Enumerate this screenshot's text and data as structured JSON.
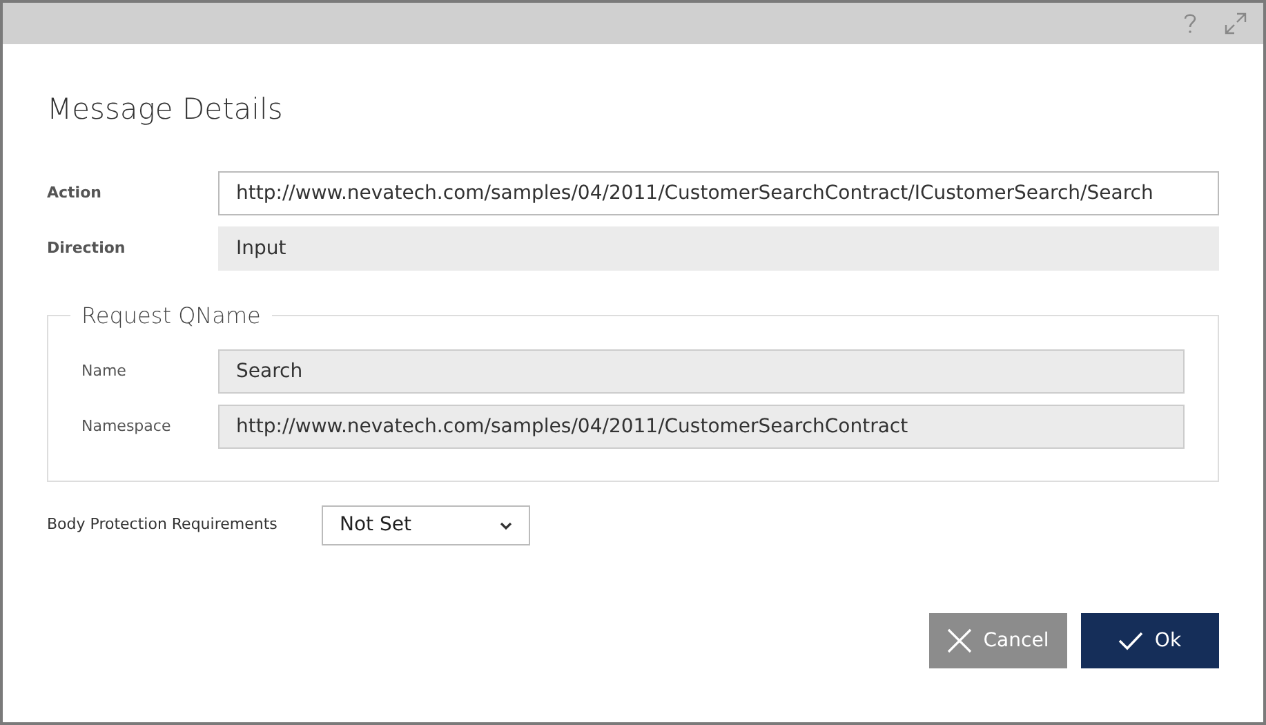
{
  "dialog": {
    "title": "Message Details"
  },
  "fields": [
    {
      "label": "Action",
      "value": "http://www.nevatech.com/samples/04/2011/CustomerSearchContract/ICustomerSearch/Search",
      "kind": "editable"
    },
    {
      "label": "Direction",
      "value": "Input",
      "kind": "readonly"
    }
  ],
  "request_qname": {
    "legend": "Request QName",
    "fields": [
      {
        "label": "Name",
        "value": "Search",
        "kind": "readonly"
      },
      {
        "label": "Namespace",
        "value": "http://www.nevatech.com/samples/04/2011/CustomerSearchContract",
        "kind": "readonly"
      }
    ]
  },
  "body_protection": {
    "label": "Body Protection Requirements",
    "value": "Not Set"
  },
  "buttons": [
    {
      "label": "Cancel",
      "kind": "cancel"
    },
    {
      "label": "Ok",
      "kind": "ok"
    }
  ]
}
